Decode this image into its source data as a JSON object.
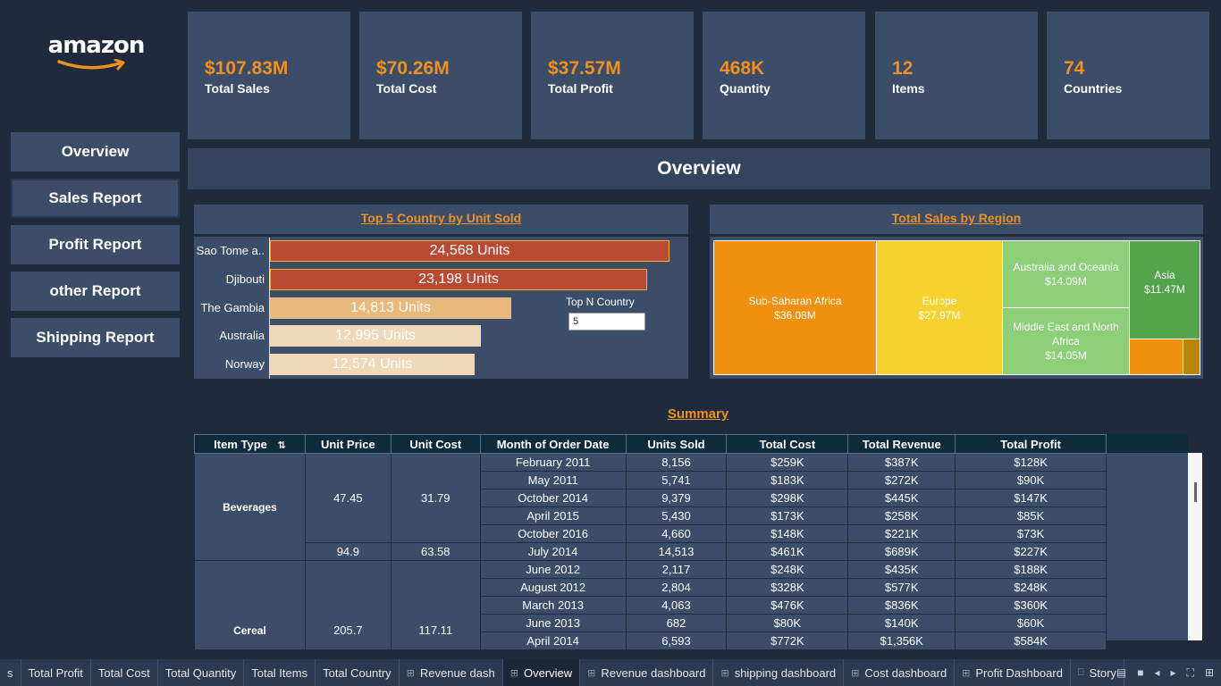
{
  "logo": {
    "text": "amazon"
  },
  "nav": [
    "Overview",
    "Sales Report",
    "Profit Report",
    "other Report",
    "Shipping Report"
  ],
  "kpis": [
    {
      "value": "$107.83M",
      "label": "Total Sales"
    },
    {
      "value": "$70.26M",
      "label": "Total Cost"
    },
    {
      "value": "$37.57M",
      "label": "Total Profit"
    },
    {
      "value": "468K",
      "label": "Quantity"
    },
    {
      "value": "12",
      "label": "Items"
    },
    {
      "value": "74",
      "label": "Countries"
    }
  ],
  "page_title": "Overview",
  "top_countries": {
    "title": "Top 5 Country by Unit Sold",
    "bars": [
      {
        "country": "Sao Tome a..",
        "label": "24,568 Units",
        "value": 24568,
        "color": "#b84a34",
        "border": "#f0b429"
      },
      {
        "country": "Djibouti",
        "label": "23,198 Units",
        "value": 23198,
        "color": "#b84a34",
        "border": "#f0b429"
      },
      {
        "country": "The Gambia",
        "label": "14,813 Units",
        "value": 14813,
        "color": "#e8b97a",
        "border": "#e8b97a"
      },
      {
        "country": "Australia",
        "label": "12,995 Units",
        "value": 12995,
        "color": "#efd8b8",
        "border": "#efd8b8"
      },
      {
        "country": "Norway",
        "label": "12,574 Units",
        "value": 12574,
        "color": "#efd8b8",
        "border": "#efd8b8"
      }
    ],
    "topn_label": "Top N Country",
    "topn_value": "5"
  },
  "region": {
    "title": "Total Sales by Region",
    "cells": [
      {
        "name": "Sub-Saharan Africa",
        "value": "$36.08M",
        "color": "#f0900f"
      },
      {
        "name": "Europe",
        "value": "$27.97M",
        "color": "#f5d22e"
      },
      {
        "name": "Australia and Oceania",
        "value": "$14.09M",
        "color": "#8ccf78"
      },
      {
        "name": "Middle East and North Africa",
        "value": "$14.05M",
        "color": "#8ccf78"
      },
      {
        "name": "Asia",
        "value": "$11.47M",
        "color": "#52a34a"
      },
      {
        "name": "",
        "value": "",
        "color": "#f0900f"
      },
      {
        "name": "",
        "value": "",
        "color": "#b8860b"
      }
    ]
  },
  "summary": {
    "title": "Summary",
    "headers": [
      "Item Type",
      "Unit Price",
      "Unit Cost",
      "Month of Order Date",
      "Units Sold",
      "Total Cost",
      "Total Revenue",
      "Total Profit"
    ],
    "groups": [
      {
        "item": "Beverages",
        "prices": [
          {
            "price": "47.45",
            "cost": "31.79"
          },
          {
            "price": "94.9",
            "cost": "63.58"
          }
        ]
      },
      {
        "item": "Cereal",
        "prices": [
          {
            "price": "205.7",
            "cost": "117.11"
          }
        ]
      }
    ],
    "rows": [
      [
        "February 2011",
        "8,156",
        "$259K",
        "$387K",
        "$128K"
      ],
      [
        "May 2011",
        "5,741",
        "$183K",
        "$272K",
        "$90K"
      ],
      [
        "October 2014",
        "9,379",
        "$298K",
        "$445K",
        "$147K"
      ],
      [
        "April 2015",
        "5,430",
        "$173K",
        "$258K",
        "$85K"
      ],
      [
        "October 2016",
        "4,660",
        "$148K",
        "$221K",
        "$73K"
      ],
      [
        "July 2014",
        "14,513",
        "$461K",
        "$689K",
        "$227K"
      ],
      [
        "June 2012",
        "2,117",
        "$248K",
        "$435K",
        "$188K"
      ],
      [
        "August 2012",
        "2,804",
        "$328K",
        "$577K",
        "$248K"
      ],
      [
        "March 2013",
        "4,063",
        "$476K",
        "$836K",
        "$360K"
      ],
      [
        "June 2013",
        "682",
        "$80K",
        "$140K",
        "$60K"
      ],
      [
        "April 2014",
        "6,593",
        "$772K",
        "$1,356K",
        "$584K"
      ]
    ]
  },
  "tabs": [
    {
      "label": "s",
      "icon": false
    },
    {
      "label": "Total Profit",
      "icon": false
    },
    {
      "label": "Total Cost",
      "icon": false
    },
    {
      "label": "Total Quantity",
      "icon": false
    },
    {
      "label": "Total Items",
      "icon": false
    },
    {
      "label": "Total Country",
      "icon": false
    },
    {
      "label": "Revenue dash",
      "icon": true
    },
    {
      "label": "Overview",
      "icon": true,
      "active": true
    },
    {
      "label": "Revenue dashboard",
      "icon": true
    },
    {
      "label": "shipping dashboard",
      "icon": true
    },
    {
      "label": "Cost dashboard",
      "icon": true
    },
    {
      "label": "Profit Dashboard",
      "icon": true
    },
    {
      "label": "Story",
      "icon": true
    }
  ]
}
